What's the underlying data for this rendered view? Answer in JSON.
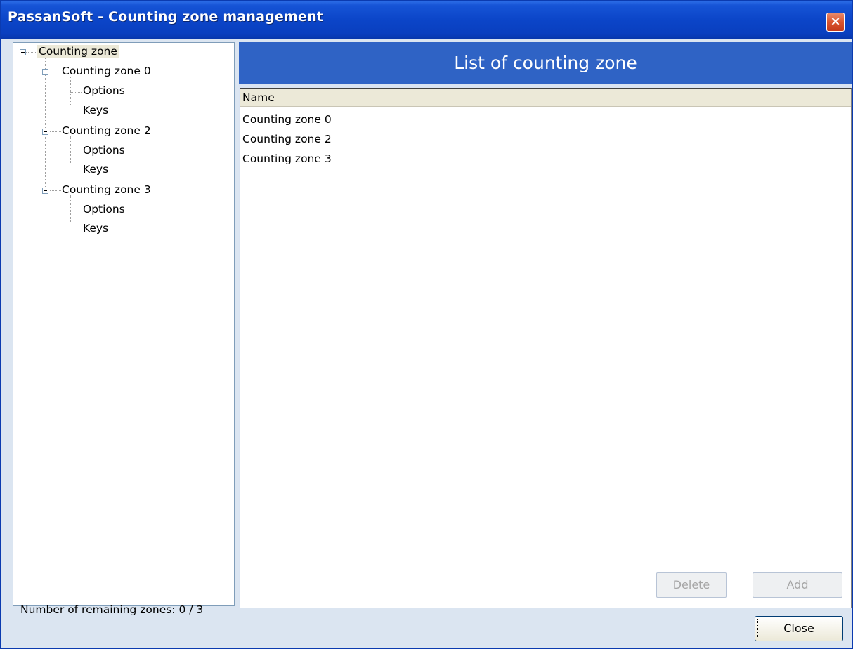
{
  "window": {
    "title": "PassanSoft - Counting zone management",
    "close_glyph": "×"
  },
  "tree": {
    "root": "Counting zone",
    "zones": [
      {
        "label": "Counting zone 0",
        "children": [
          "Options",
          "Keys"
        ]
      },
      {
        "label": "Counting zone 2",
        "children": [
          "Options",
          "Keys"
        ]
      },
      {
        "label": "Counting zone 3",
        "children": [
          "Options",
          "Keys"
        ]
      }
    ]
  },
  "panel": {
    "title": "List of counting zone",
    "column_name": "Name",
    "rows": [
      "Counting zone 0",
      "Counting zone 2",
      "Counting zone 3"
    ],
    "delete_label": "Delete",
    "add_label": "Add"
  },
  "status": {
    "remaining_zones": "Number of remaining zones: 0 / 3"
  },
  "footer": {
    "close_label": "Close"
  },
  "colors": {
    "titlebar": "#0a3fbf",
    "banner": "#2f63c5",
    "body": "#dbe5f1",
    "close_red": "#d9542e"
  }
}
